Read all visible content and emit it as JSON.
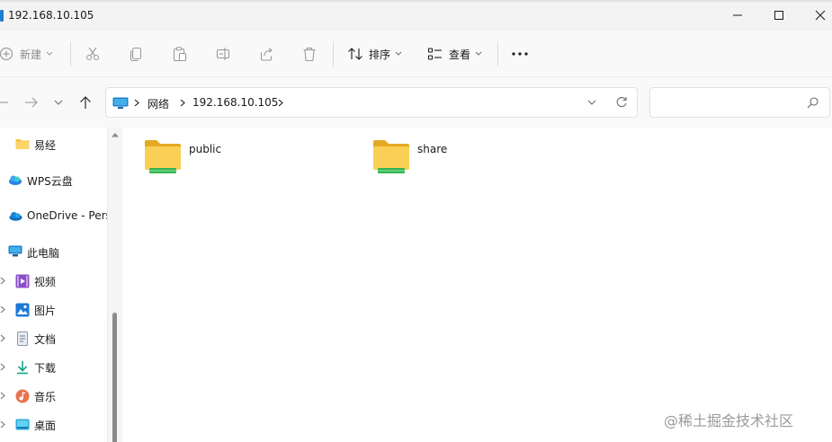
{
  "window": {
    "title": "192.168.10.105"
  },
  "toolbar": {
    "new_label": "新建",
    "sort_label": "排序",
    "view_label": "查看",
    "more_label": "···"
  },
  "address": {
    "crumbs": [
      "网络",
      "192.168.10.105"
    ]
  },
  "search": {
    "placeholder": ""
  },
  "sidebar": {
    "items": [
      {
        "label": "易经",
        "icon": "folder-icon"
      },
      {
        "label": "WPS云盘",
        "icon": "wps-cloud-icon"
      },
      {
        "label": "OneDrive - Pers",
        "icon": "onedrive-icon"
      },
      {
        "label": "此电脑",
        "icon": "pc-icon"
      },
      {
        "label": "视频",
        "icon": "video-icon"
      },
      {
        "label": "图片",
        "icon": "pictures-icon"
      },
      {
        "label": "文档",
        "icon": "documents-icon"
      },
      {
        "label": "下载",
        "icon": "downloads-icon"
      },
      {
        "label": "音乐",
        "icon": "music-icon"
      },
      {
        "label": "桌面",
        "icon": "desktop-icon"
      }
    ]
  },
  "content": {
    "items": [
      {
        "name": "public",
        "type": "network-share-folder"
      },
      {
        "name": "share",
        "type": "network-share-folder"
      }
    ]
  },
  "watermark": "@稀土掘金技术社区",
  "colors": {
    "accent": "#1e7fd0",
    "folder": "#f5c343",
    "share_bar": "#33b552"
  }
}
